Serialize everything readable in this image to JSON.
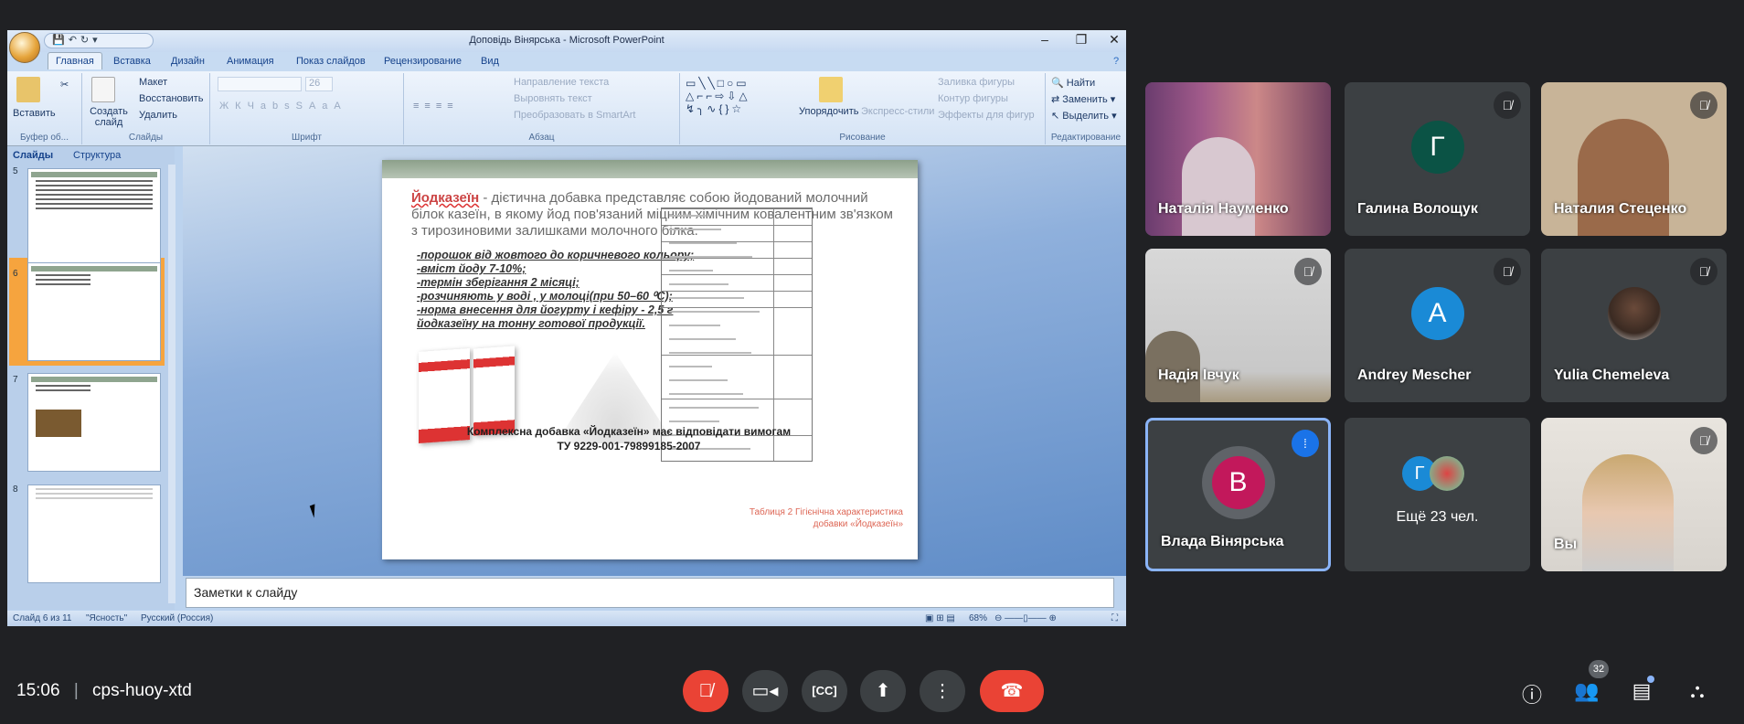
{
  "ppt": {
    "title": "Доповідь Вінярська - Microsoft PowerPoint",
    "tabs": [
      "Главная",
      "Вставка",
      "Дизайн",
      "Анимация",
      "Показ слайдов",
      "Рецензирование",
      "Вид"
    ],
    "ribbon": {
      "paste": "Вставить",
      "new_slide": "Создать слайд",
      "layout": "Макет",
      "reset": "Восстановить",
      "delete": "Удалить",
      "font_size": "26",
      "text_direction": "Направление текста",
      "align_text": "Выровнять текст",
      "smartart": "Преобразовать в SmartArt",
      "arrange": "Упорядочить",
      "quick_styles": "Экспресс-стили",
      "shape_fill": "Заливка фигуры",
      "shape_outline": "Контур фигуры",
      "shape_effects": "Эффекты для фигур",
      "find": "Найти",
      "replace": "Заменить",
      "select": "Выделить",
      "groups": [
        "Буфер об...",
        "Слайды",
        "Шрифт",
        "Абзац",
        "Рисование",
        "Редактирование"
      ]
    },
    "left_pane": {
      "tabs": [
        "Слайды",
        "Структура"
      ],
      "slide_numbers": [
        "5",
        "6",
        "7",
        "8"
      ],
      "selected": "6"
    },
    "slide": {
      "keyword": "Йодказеїн",
      "paragraph": " - дієтична добавка представляє собою йодований молочний білок казеїн, в якому йод пов'язаний міцним хімічним ковалентним зв'язком з тирозиновими залишками молочного білка.",
      "bullets": [
        "-порошок від жовтого до коричневого кольору;",
        "-вміст йоду 7-10%;",
        "-термін зберігання  2 місяці;",
        "-розчиняють у воді , у молоці(при  50–60  ⁰С);",
        "-норма внесення  для йогурту  і кефіру - 2,5 г йодказеїну на тонну готової продукції."
      ],
      "bottom_line1": "Комплексна добавка «Йодказеїн» має відповідати вимогам",
      "bottom_line2": "ТУ 9229-001-79899185-2007",
      "table_caption": "Таблиця 2 Гігієнічна характеристика добавки «Йодказеїн»"
    },
    "notes_placeholder": "Заметки к слайду",
    "status": {
      "slide": "Слайд 6 из 11",
      "theme": "\"Ясность\"",
      "language": "Русский (Россия)",
      "zoom": "68%"
    }
  },
  "participants": [
    {
      "name": "Наталія Науменко",
      "type": "video",
      "muted": false
    },
    {
      "name": "Галина Волощук",
      "type": "avatar",
      "initial": "Г",
      "color": "#0b5345",
      "muted": true
    },
    {
      "name": "Наталия Стеценко",
      "type": "video",
      "muted": true
    },
    {
      "name": "Надія Івчук",
      "type": "video",
      "muted": true
    },
    {
      "name": "Andrey Mescher",
      "type": "avatar",
      "initial": "A",
      "color": "#1a8ad6",
      "muted": true
    },
    {
      "name": "Yulia Chemeleva",
      "type": "photo-avatar",
      "muted": true
    },
    {
      "name": "Влада Вінярська",
      "type": "avatar",
      "initial": "В",
      "color": "#c2185b",
      "speaking": true
    },
    {
      "name": "Ещё 23 чел.",
      "type": "more",
      "initial": "Г"
    },
    {
      "name": "Вы",
      "type": "video",
      "muted": true
    }
  ],
  "bottom_bar": {
    "time": "15:06",
    "meeting_code": "cps-huoy-xtd",
    "people_count": "32",
    "accent_red": "#ea4335",
    "speaking_blue": "#8ab4f8"
  }
}
